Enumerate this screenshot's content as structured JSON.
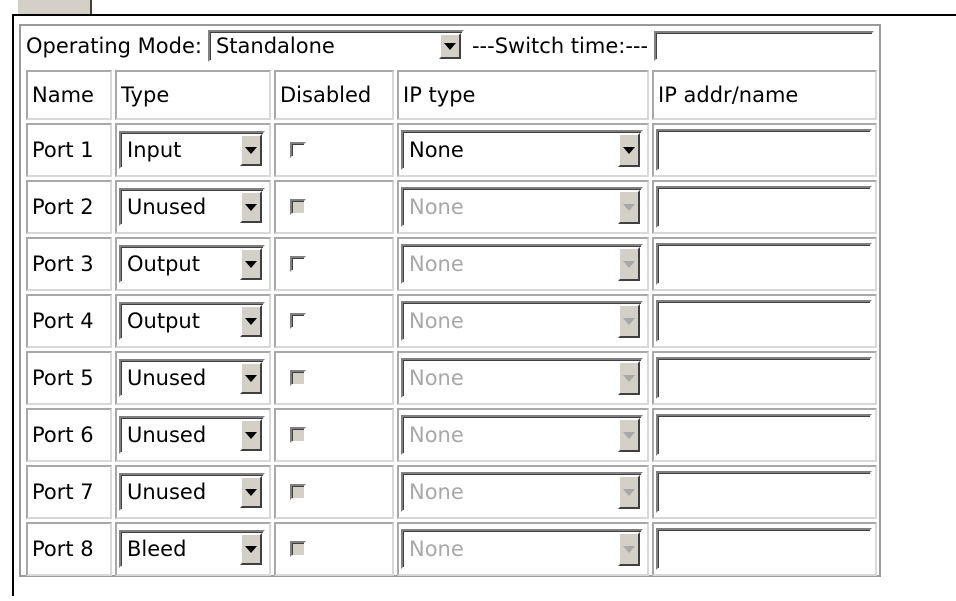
{
  "operating_mode": {
    "label": "Operating Mode:",
    "value": "Standalone",
    "switch_time_label": "---Switch time:---",
    "switch_time_value": ""
  },
  "table": {
    "headers": {
      "name": "Name",
      "type": "Type",
      "disabled": "Disabled",
      "ip_type": "IP type",
      "ip_addr": "IP addr/name"
    },
    "rows": [
      {
        "name": "Port 1",
        "type": "Input",
        "disabled_checked": false,
        "disabled_enabled": true,
        "ip_type": "None",
        "ip_type_enabled": true,
        "ip_addr": ""
      },
      {
        "name": "Port 2",
        "type": "Unused",
        "disabled_checked": false,
        "disabled_enabled": false,
        "ip_type": "None",
        "ip_type_enabled": false,
        "ip_addr": ""
      },
      {
        "name": "Port 3",
        "type": "Output",
        "disabled_checked": false,
        "disabled_enabled": true,
        "ip_type": "None",
        "ip_type_enabled": false,
        "ip_addr": ""
      },
      {
        "name": "Port 4",
        "type": "Output",
        "disabled_checked": false,
        "disabled_enabled": true,
        "ip_type": "None",
        "ip_type_enabled": false,
        "ip_addr": ""
      },
      {
        "name": "Port 5",
        "type": "Unused",
        "disabled_checked": false,
        "disabled_enabled": false,
        "ip_type": "None",
        "ip_type_enabled": false,
        "ip_addr": ""
      },
      {
        "name": "Port 6",
        "type": "Unused",
        "disabled_checked": false,
        "disabled_enabled": false,
        "ip_type": "None",
        "ip_type_enabled": false,
        "ip_addr": ""
      },
      {
        "name": "Port 7",
        "type": "Unused",
        "disabled_checked": false,
        "disabled_enabled": false,
        "ip_type": "None",
        "ip_type_enabled": false,
        "ip_addr": ""
      },
      {
        "name": "Port 8",
        "type": "Bleed",
        "disabled_checked": false,
        "disabled_enabled": false,
        "ip_type": "None",
        "ip_type_enabled": false,
        "ip_addr": ""
      }
    ]
  },
  "icons": {
    "dropdown": "chevron-down-icon"
  },
  "colors": {
    "disabled_text": "#a8a8a8",
    "control_face": "#d4d0c8"
  }
}
